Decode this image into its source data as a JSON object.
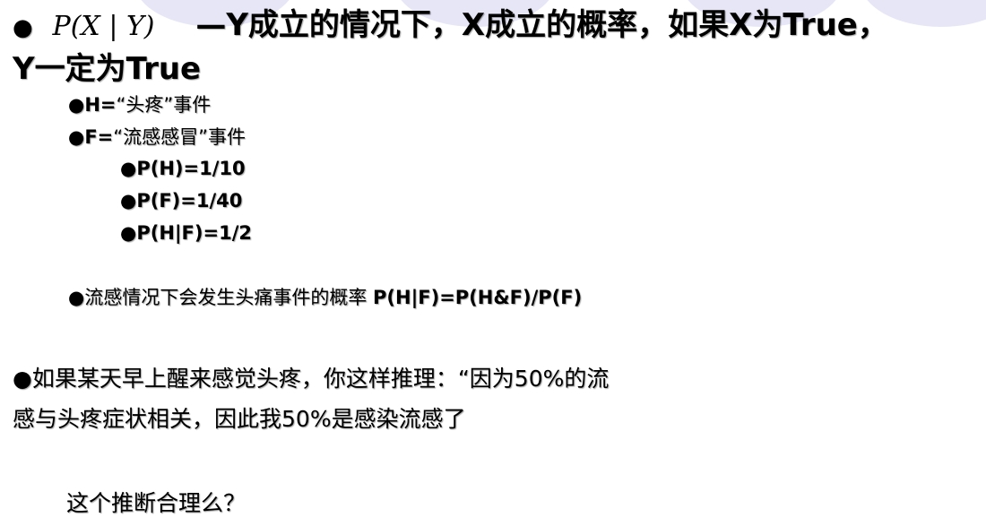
{
  "bullet": "●",
  "line1": {
    "formula": "P(X | Y)",
    "text": "—Y成立的情况下，X成立的概率，如果X为True，"
  },
  "line2": {
    "text": "Y一定为True"
  },
  "sub": {
    "h_label": "H=",
    "h_desc": "“头疼”事件",
    "f_label": "F=",
    "f_desc": "“流感感冒”事件"
  },
  "probs": [
    "P(H)=1/10",
    "P(F)=1/40",
    "P(H|F)=1/2"
  ],
  "flu": {
    "text": "流感情况下会发生头痛事件的概率 ",
    "formula": "P(H|F)=P(H&F)/P(F)"
  },
  "reason": {
    "line1": "如果某天早上醒来感觉头疼，你这样推理：“因为50%的流",
    "line2": "感与头疼症状相关，因此我50%是感染流感了"
  },
  "question": "这个推断合理么？"
}
